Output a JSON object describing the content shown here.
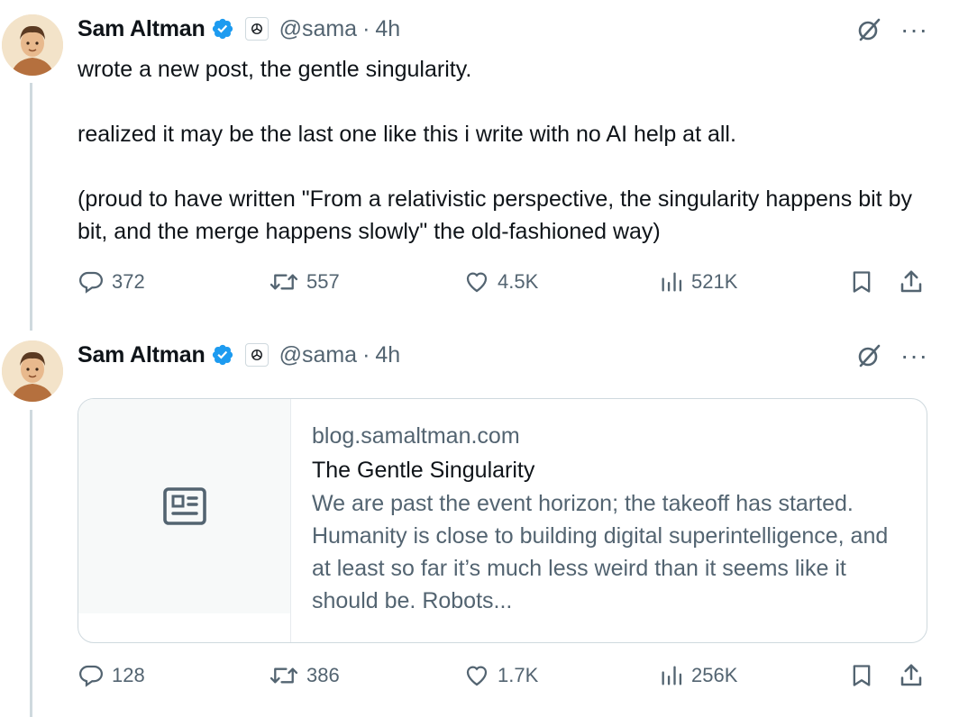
{
  "tweets": [
    {
      "author_name": "Sam Altman",
      "handle": "@sama",
      "separator": "·",
      "time": "4h",
      "text_lines": [
        "wrote a new post, the gentle singularity.",
        "realized it may be the last one like this i write with no AI help at all.",
        "(proud to have written \"From a relativistic perspective, the singularity happens bit by bit, and the merge happens slowly\" the old-fashioned way)"
      ],
      "replies": "372",
      "reposts": "557",
      "likes": "4.5K",
      "views": "521K"
    },
    {
      "author_name": "Sam Altman",
      "handle": "@sama",
      "separator": "·",
      "time": "4h",
      "card": {
        "domain": "blog.samaltman.com",
        "title": "The Gentle Singularity",
        "description": "We are past the event horizon; the takeoff has started. Humanity is close to building digital superintelligence, and at least so far it’s much less weird than it seems like it should be. Robots..."
      },
      "replies": "128",
      "reposts": "386",
      "likes": "1.7K",
      "views": "256K"
    }
  ],
  "colors": {
    "text_primary": "#0f1419",
    "text_secondary": "#536471",
    "verified_blue": "#1d9bf0",
    "border": "#cfd9de"
  },
  "icons": {
    "verified": "verified-badge-icon",
    "org": "openai-logo-icon",
    "grok": "grok-icon",
    "more": "more-icon",
    "reply": "reply-icon",
    "repost": "repost-icon",
    "like": "like-icon",
    "views": "views-icon",
    "bookmark": "bookmark-icon",
    "share": "share-icon",
    "article": "article-icon"
  }
}
